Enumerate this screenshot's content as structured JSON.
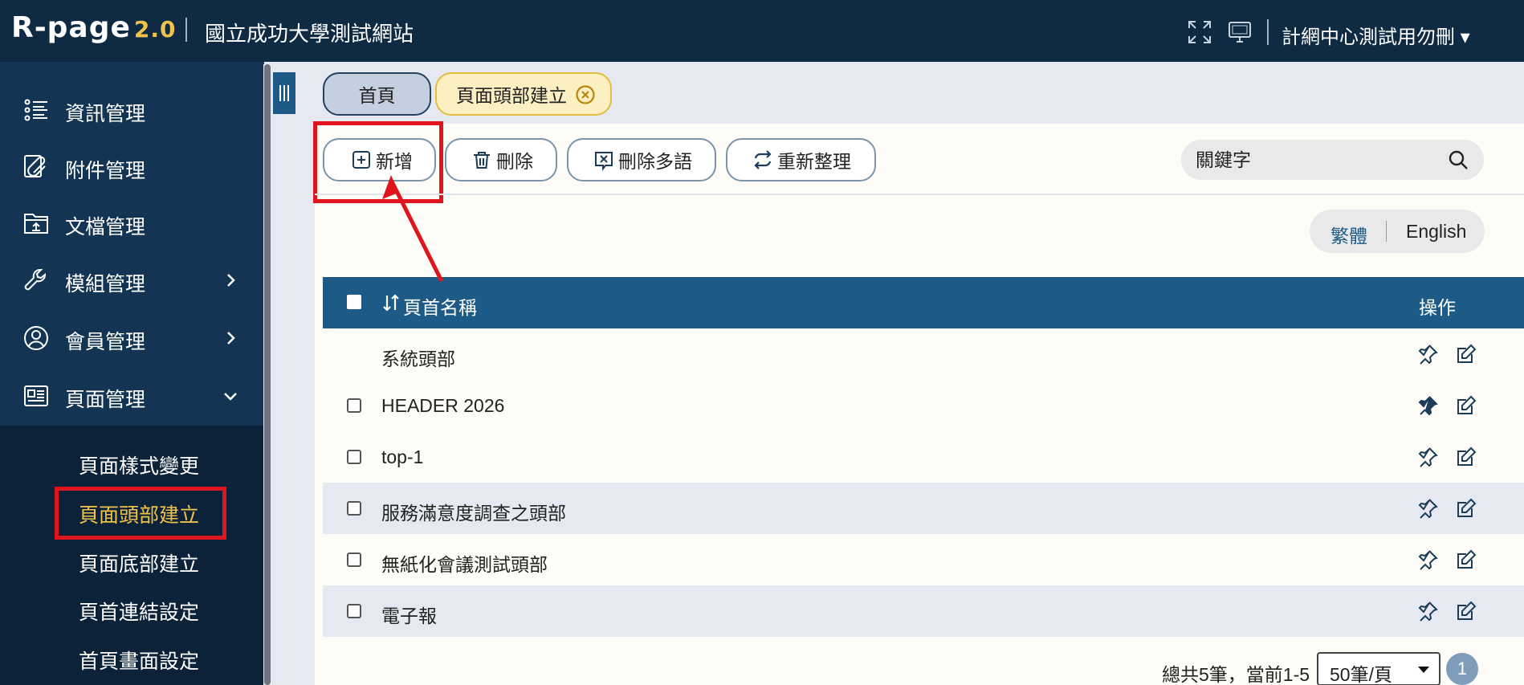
{
  "header": {
    "logo_main": "R-page",
    "logo_version": "2.0",
    "site_title": "國立成功大學測試網站",
    "user_menu": "計網中心測試用勿刪 ▾",
    "icons": [
      "fullscreen-icon",
      "monitor-icon"
    ]
  },
  "sidebar": {
    "items": [
      {
        "label": "資訊管理",
        "icon": "list-icon"
      },
      {
        "label": "附件管理",
        "icon": "attachment-icon"
      },
      {
        "label": "文檔管理",
        "icon": "folder-upload-icon"
      },
      {
        "label": "模組管理",
        "icon": "wrench-icon",
        "has_children": true
      },
      {
        "label": "會員管理",
        "icon": "user-icon",
        "has_children": true
      },
      {
        "label": "頁面管理",
        "icon": "newspaper-icon",
        "expanded": true
      }
    ],
    "submenu": [
      {
        "label": "頁面樣式變更"
      },
      {
        "label": "頁面頭部建立",
        "active": true
      },
      {
        "label": "頁面底部建立"
      },
      {
        "label": "頁首連結設定"
      },
      {
        "label": "首頁畫面設定"
      }
    ]
  },
  "tabs": {
    "home": "首頁",
    "active": "頁面頭部建立"
  },
  "toolbar": {
    "add": "新增",
    "delete": "刪除",
    "delete_multilang": "刪除多語",
    "refresh": "重新整理"
  },
  "search": {
    "placeholder": "關鍵字"
  },
  "lang": {
    "zh": "繁體",
    "en": "English"
  },
  "table": {
    "column_name": "頁首名稱",
    "column_ops": "操作",
    "rows": [
      {
        "name": "系統頭部",
        "checkbox": false,
        "pinned": false
      },
      {
        "name": "HEADER 2026",
        "checkbox": true,
        "pinned": true
      },
      {
        "name": "top-1",
        "checkbox": true,
        "pinned": false
      },
      {
        "name": "服務滿意度調查之頭部",
        "checkbox": true,
        "pinned": false
      },
      {
        "name": "無紙化會議測試頭部",
        "checkbox": true,
        "pinned": false
      },
      {
        "name": "電子報",
        "checkbox": true,
        "pinned": false
      }
    ]
  },
  "pagination": {
    "summary": "總共5筆，當前1-5",
    "per_page": "50筆/頁",
    "current_page": "1"
  },
  "colors": {
    "topbar": "#0f2a43",
    "sidebar": "#133553",
    "accent": "#1d5b86",
    "highlight": "#e0141c",
    "active_text": "#f0c24b"
  }
}
